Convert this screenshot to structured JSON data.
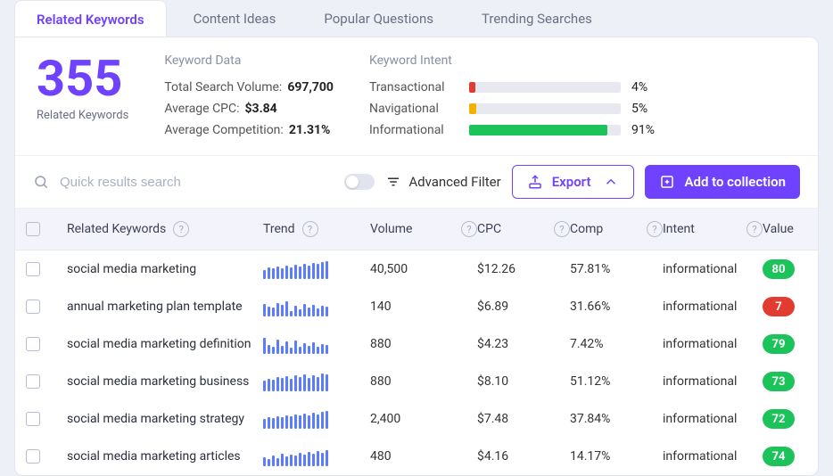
{
  "tabs": [
    {
      "label": "Related Keywords"
    },
    {
      "label": "Content Ideas"
    },
    {
      "label": "Popular Questions"
    },
    {
      "label": "Trending Searches"
    }
  ],
  "summary": {
    "count": "355",
    "count_label": "Related Keywords",
    "kwdata_head": "Keyword Data",
    "total_volume_label": "Total Search Volume:",
    "total_volume": "697,700",
    "avg_cpc_label": "Average CPC:",
    "avg_cpc": "$3.84",
    "avg_comp_label": "Average Competition:",
    "avg_comp": "21.31%",
    "intent_head": "Keyword Intent",
    "intents": [
      {
        "label": "Transactional",
        "pct": "4%",
        "width": 4,
        "color": "#e23b30"
      },
      {
        "label": "Navigational",
        "pct": "5%",
        "width": 5,
        "color": "#f1b300"
      },
      {
        "label": "Informational",
        "pct": "91%",
        "width": 91,
        "color": "#1bc35a"
      }
    ]
  },
  "toolbar": {
    "search_placeholder": "Quick results search",
    "advanced_filter": "Advanced Filter",
    "export": "Export",
    "add": "Add to collection"
  },
  "columns": {
    "related": "Related Keywords",
    "trend": "Trend",
    "volume": "Volume",
    "cpc": "CPC",
    "comp": "Comp",
    "intent": "Intent",
    "value": "Value"
  },
  "rows": [
    {
      "kw": "social media marketing",
      "trend": [
        10,
        13,
        12,
        14,
        12,
        15,
        13,
        16,
        14,
        17,
        15,
        18,
        17,
        19,
        20
      ],
      "volume": "40,500",
      "cpc": "$12.26",
      "comp": "57.81%",
      "intent": "informational",
      "value": "80",
      "pill": "green"
    },
    {
      "kw": "annual marketing plan template",
      "trend": [
        14,
        11,
        10,
        15,
        13,
        17,
        6,
        12,
        8,
        14,
        10,
        13,
        9,
        12,
        11
      ],
      "volume": "140",
      "cpc": "$6.89",
      "comp": "31.66%",
      "intent": "informational",
      "value": "7",
      "pill": "red"
    },
    {
      "kw": "social media marketing definition",
      "trend": [
        18,
        10,
        8,
        16,
        9,
        14,
        7,
        15,
        8,
        12,
        9,
        13,
        8,
        11,
        10
      ],
      "volume": "880",
      "cpc": "$4.23",
      "comp": "7.42%",
      "intent": "informational",
      "value": "79",
      "pill": "green"
    },
    {
      "kw": "social media marketing business",
      "trend": [
        12,
        14,
        13,
        16,
        15,
        17,
        14,
        18,
        16,
        19,
        15,
        18,
        16,
        20,
        19
      ],
      "volume": "880",
      "cpc": "$8.10",
      "comp": "51.12%",
      "intent": "informational",
      "value": "73",
      "pill": "green"
    },
    {
      "kw": "social media marketing strategy",
      "trend": [
        11,
        13,
        12,
        14,
        13,
        15,
        14,
        16,
        15,
        17,
        15,
        18,
        16,
        19,
        20
      ],
      "volume": "2,400",
      "cpc": "$7.48",
      "comp": "37.84%",
      "intent": "informational",
      "value": "72",
      "pill": "green"
    },
    {
      "kw": "social media marketing articles",
      "trend": [
        10,
        8,
        12,
        9,
        14,
        11,
        13,
        12,
        15,
        13,
        16,
        14,
        17,
        15,
        18
      ],
      "volume": "480",
      "cpc": "$4.16",
      "comp": "14.17%",
      "intent": "informational",
      "value": "74",
      "pill": "green"
    }
  ]
}
